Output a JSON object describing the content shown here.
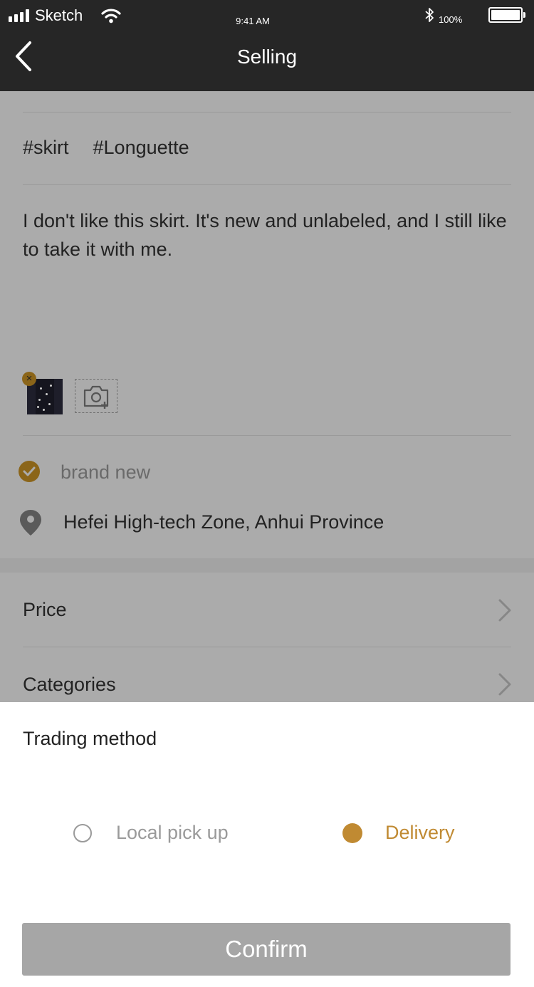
{
  "status": {
    "carrier": "Sketch",
    "time": "9:41 AM",
    "battery": "100%"
  },
  "nav": {
    "title": "Selling"
  },
  "listing": {
    "tags": [
      "#skirt",
      "#Longuette"
    ],
    "description": "I don't like this skirt. It's new and unlabeled, and I still like to take it with me.",
    "condition": "brand new",
    "location": "Hefei High-tech Zone, Anhui Province"
  },
  "rows": {
    "price": "Price",
    "categories": "Categories"
  },
  "sheet": {
    "title": "Trading method",
    "options": [
      "Local pick up",
      "Delivery"
    ],
    "selected": "Delivery",
    "confirm": "Confirm"
  },
  "colors": {
    "accent": "#c08a32",
    "topbar": "#262626",
    "overlay": "#ababab",
    "button_disabled": "#a6a6a6"
  },
  "icons": [
    "signal-icon",
    "wifi-icon",
    "bluetooth-icon",
    "battery-icon",
    "back-icon",
    "remove-photo-icon",
    "add-photo-icon",
    "check-icon",
    "location-pin-icon",
    "chevron-right-icon",
    "radio-icon"
  ]
}
